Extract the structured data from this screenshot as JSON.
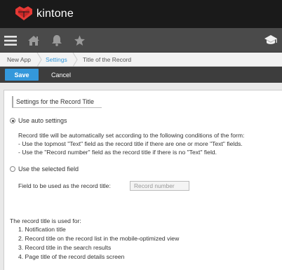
{
  "app": {
    "name": "kintone"
  },
  "icons": {
    "logo": "kintone-logo-icon",
    "menu": "hamburger-menu-icon",
    "home": "home-icon",
    "notifications": "bell-icon",
    "favorites": "star-icon",
    "app_settings": "graduation-cap-icon"
  },
  "breadcrumb": [
    "New App",
    "Settings",
    "Title of the Record"
  ],
  "toolbar": {
    "save_label": "Save",
    "cancel_label": "Cancel"
  },
  "colors": {
    "accent": "#3498db",
    "logo_red": "#e53935",
    "topbar": "#1a1a1a"
  },
  "settings": {
    "section_title": "Settings for the Record Title",
    "auto_option": {
      "label": "Use auto settings",
      "selected": true,
      "description": [
        "Record title will be automatically set according to the following conditions of the form:",
        "- Use the topmost \"Text\" field as the record title if there are one or more \"Text\" fields.",
        "- Use the \"Record number\" field as the record title if there is no \"Text\" field."
      ]
    },
    "selected_option": {
      "label": "Use the selected field",
      "selected": false,
      "field_label": "Field to be used as the record title:",
      "field_value": "Record number"
    },
    "usage": {
      "heading": "The record title is used for:",
      "items": [
        "1. Notification title",
        "2. Record title on the record list in the mobile-optimized view",
        "3. Record title in the search results",
        "4. Page title of the record details screen"
      ]
    }
  }
}
